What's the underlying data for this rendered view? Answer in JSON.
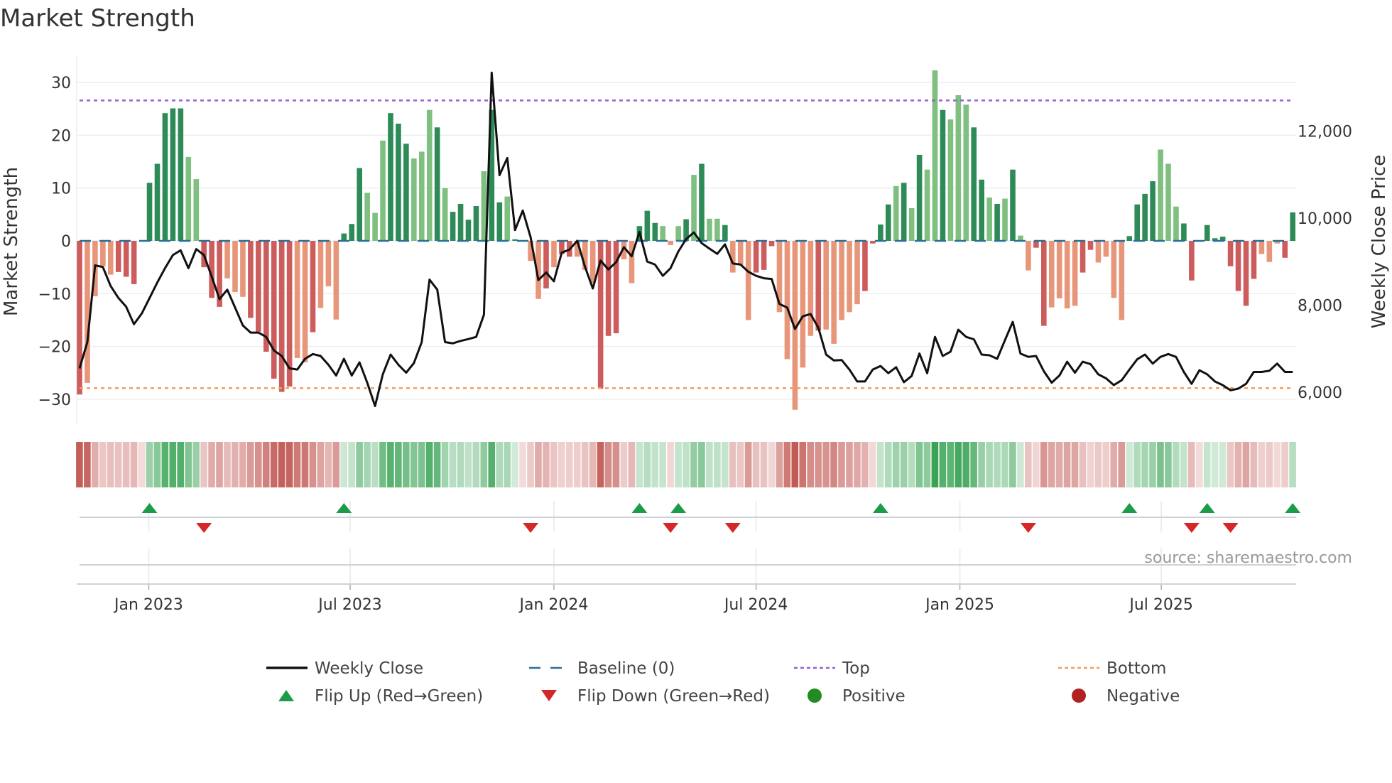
{
  "title": "Market Strength",
  "source": "source: sharemaestro.com",
  "chart_data": {
    "type": "bar+line",
    "title": "Market Strength",
    "ylabel_left": "Market Strength",
    "ylabel_right": "Weekly Close Price",
    "ylim_left": [
      -35,
      35
    ],
    "yticks_left": [
      30,
      20,
      10,
      0,
      -10,
      -20,
      -30
    ],
    "ytick_labels_left": [
      "30",
      "20",
      "10",
      "0",
      "−10",
      "−20",
      "−30"
    ],
    "yticks_right": [
      12000,
      10000,
      8000,
      6000
    ],
    "ytick_labels_right": [
      "12,000",
      "10,000",
      "8,000",
      "6,000"
    ],
    "xticks": [
      {
        "label": "Jan 2023",
        "at_week": 8.9
      },
      {
        "label": "Jul 2023",
        "at_week": 34.8
      },
      {
        "label": "Jan 2024",
        "at_week": 61.0
      },
      {
        "label": "Jul 2024",
        "at_week": 87.0
      },
      {
        "label": "Jan 2025",
        "at_week": 113.2
      },
      {
        "label": "Jul 2025",
        "at_week": 139.1
      }
    ],
    "top_level": 26.6,
    "bottom_level": -27.9,
    "baseline": 0,
    "colors": {
      "pos_strong": "#2e8b57",
      "pos_weak": "#7fbf7f",
      "neg_strong": "#cd5c5c",
      "neg_weak": "#e8967a",
      "line": "#111111",
      "baseline": "#2a6f97",
      "top": "#9a5fd6",
      "bottom": "#f0a060",
      "flip_up": "#1a9c48",
      "flip_down": "#d62728",
      "positive": "#228b22",
      "negative": "#b22222"
    },
    "strength": [
      -29.1,
      -26.9,
      -10.5,
      -4.8,
      -6.4,
      -5.9,
      -6.8,
      -8.2,
      0,
      11.0,
      14.6,
      24.2,
      25.1,
      25.1,
      15.9,
      11.7,
      -5.0,
      -10.8,
      -12.5,
      -7.1,
      -9.7,
      -10.6,
      -14.6,
      -17.2,
      -21.0,
      -26.1,
      -28.6,
      -27.6,
      -22.2,
      -23.0,
      -17.3,
      -12.7,
      -8.6,
      -14.9,
      1.4,
      3.2,
      13.8,
      9.1,
      5.3,
      19.0,
      24.2,
      22.2,
      18.4,
      15.6,
      16.9,
      24.8,
      21.5,
      10.0,
      5.5,
      7.0,
      4.0,
      6.6,
      13.2,
      24.8,
      7.3,
      8.4,
      0.3,
      0,
      -3.8,
      -11,
      -9,
      -5,
      -2.5,
      -3,
      -3,
      -5.5,
      -8,
      -28,
      -18,
      -17.5,
      -3.5,
      -8,
      2.8,
      5.7,
      3.4,
      2.8,
      -0.8,
      2.8,
      4.1,
      12.5,
      14.6,
      4.2,
      4.2,
      3.0,
      -6,
      -4.6,
      -15,
      -6,
      -5.5,
      -1,
      -13.5,
      -22.4,
      -32,
      -24,
      -18,
      -17,
      -16.8,
      -19.5,
      -15,
      -13.5,
      -12,
      -9.5,
      -0.5,
      3.1,
      6.9,
      10.4,
      11.0,
      6.2,
      16.3,
      13.5,
      32.3,
      24.8,
      23.0,
      27.6,
      25.8,
      21.5,
      11.6,
      8.2,
      7.0,
      8.0,
      13.5,
      1.0,
      -5.6,
      -1.3,
      -16.1,
      -12.6,
      -10.9,
      -12.8,
      -12.3,
      -6.0,
      -1.7,
      -4.1,
      -3.0,
      -10.8,
      -15.0,
      0.9,
      6.9,
      8.9,
      11.3,
      17.3,
      14.6,
      6.5,
      3.3,
      -7.5,
      0,
      3.0,
      0.5,
      0.8,
      -4.8,
      -9.5,
      -12.3,
      -7.2,
      -2.5,
      -4.0,
      -0.5,
      -3.2,
      5.4
    ],
    "shade": "dlllldddddddddllddd lllddddddlld llldddllldddllldldddd ldd lddlldlddl lldddlldddlll dldl ldllldddllllldllll ldddd ldldlldlllddldldllddllllddllllddddllldd ldddddddllldd dldddddllld ld",
    "weekly_close": [
      6548,
      7151,
      8915,
      8877,
      8439,
      8165,
      7962,
      7562,
      7808,
      8165,
      8521,
      8850,
      9151,
      9260,
      8850,
      9288,
      9151,
      8658,
      8137,
      8356,
      7945,
      7534,
      7370,
      7370,
      7271,
      6959,
      6833,
      6548,
      6521,
      6767,
      6877,
      6833,
      6630,
      6384,
      6767,
      6384,
      6685,
      6219,
      5682,
      6411,
      6866,
      6630,
      6449,
      6669,
      7151,
      8587,
      8356,
      7151,
      7123,
      7178,
      7222,
      7271,
      7781,
      13343,
      10987,
      11381,
      9726,
      10175,
      9562,
      8576,
      8751,
      8548,
      9206,
      9277,
      9480,
      8877,
      8384,
      9025,
      8822,
      8987,
      9332,
      9124,
      9683,
      9003,
      8932,
      8674,
      8850,
      9233,
      9518,
      9672,
      9425,
      9299,
      9178,
      9398,
      8959,
      8932,
      8767,
      8674,
      8619,
      8603,
      8027,
      7945,
      7452,
      7743,
      7797,
      7480,
      6866,
      6729,
      6740,
      6521,
      6247,
      6247,
      6521,
      6603,
      6438,
      6575,
      6230,
      6373,
      6888,
      6438,
      7271,
      6833,
      6932,
      7436,
      7271,
      7217,
      6866,
      6849,
      6767,
      7195,
      7617,
      6888,
      6811,
      6833,
      6482,
      6219,
      6384,
      6701,
      6449,
      6701,
      6647,
      6411,
      6318,
      6164,
      6274,
      6521,
      6756,
      6866,
      6658,
      6811,
      6877,
      6811,
      6466,
      6192,
      6504,
      6411,
      6247,
      6164,
      6044,
      6082,
      6192,
      6466,
      6466,
      6493,
      6658,
      6466,
      6466
    ],
    "flip_up_weeks": [
      9,
      34,
      72,
      77,
      103,
      135,
      145,
      156
    ],
    "flip_down_weeks": [
      16,
      58,
      76,
      84,
      122,
      143,
      148
    ],
    "legend": [
      {
        "key": "line",
        "label": "Weekly Close"
      },
      {
        "key": "baseline",
        "label": "Baseline (0)"
      },
      {
        "key": "top",
        "label": "Top"
      },
      {
        "key": "bottom",
        "label": "Bottom"
      },
      {
        "key": "flip_up",
        "label": "Flip Up (Red→Green)"
      },
      {
        "key": "flip_down",
        "label": "Flip Down (Green→Red)"
      },
      {
        "key": "positive",
        "label": "Positive"
      },
      {
        "key": "negative",
        "label": "Negative"
      }
    ],
    "legend_position": "bottom"
  }
}
